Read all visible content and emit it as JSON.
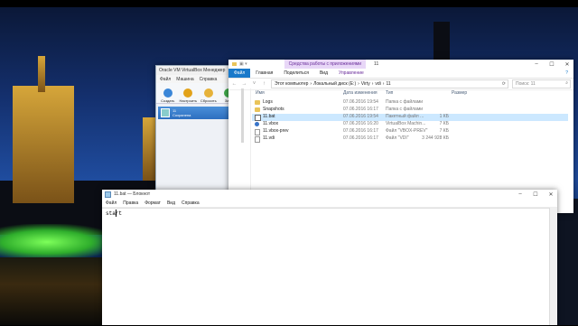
{
  "virtualbox": {
    "title": "Oracle VM VirtualBox Менеджер",
    "menu": [
      "Файл",
      "Машина",
      "Справка"
    ],
    "tools": [
      "Создать",
      "Настроить",
      "Сбросить",
      "Запу"
    ],
    "vm": {
      "name": "11",
      "state": "Сохранена"
    }
  },
  "explorer": {
    "context_tab": "Средства работы с приложениями",
    "window_title": "11",
    "ribbon_tabs": [
      "Файл",
      "Главная",
      "Поделиться",
      "Вид",
      "Управление"
    ],
    "address": [
      "Этот компьютер",
      "Локальный диск (E:)",
      "Virty",
      "vdi",
      "11"
    ],
    "search_placeholder": "Поиск: 11",
    "columns": [
      "Имя",
      "Дата изменения",
      "Тип",
      "Размер"
    ],
    "files": [
      {
        "name": "Logs",
        "date": "07.06.2016 19:54",
        "type": "Папка с файлами",
        "size": "",
        "icon": "folder",
        "selected": false
      },
      {
        "name": "Snapshots",
        "date": "07.06.2016 16:17",
        "type": "Папка с файлами",
        "size": "",
        "icon": "folder",
        "selected": false
      },
      {
        "name": "11.bat",
        "date": "07.06.2016 19:54",
        "type": "Пакетный файл ...",
        "size": "1 КБ",
        "icon": "bat",
        "selected": true
      },
      {
        "name": "11.vbox",
        "date": "07.06.2016 16:20",
        "type": "VirtualBox Machin...",
        "size": "7 КБ",
        "icon": "vbox",
        "selected": false
      },
      {
        "name": "11.vbox-prev",
        "date": "07.06.2016 16:17",
        "type": "Файл \"VBOX-PREV\"",
        "size": "7 КБ",
        "icon": "doc",
        "selected": false
      },
      {
        "name": "11.vdi",
        "date": "07.06.2016 16:17",
        "type": "Файл \"VDI\"",
        "size": "3 244 928 КБ",
        "icon": "doc",
        "selected": false
      }
    ]
  },
  "notepad": {
    "title": "11.bat — Блокнот",
    "menu": [
      "Файл",
      "Правка",
      "Формат",
      "Вид",
      "Справка"
    ],
    "content": "start"
  }
}
